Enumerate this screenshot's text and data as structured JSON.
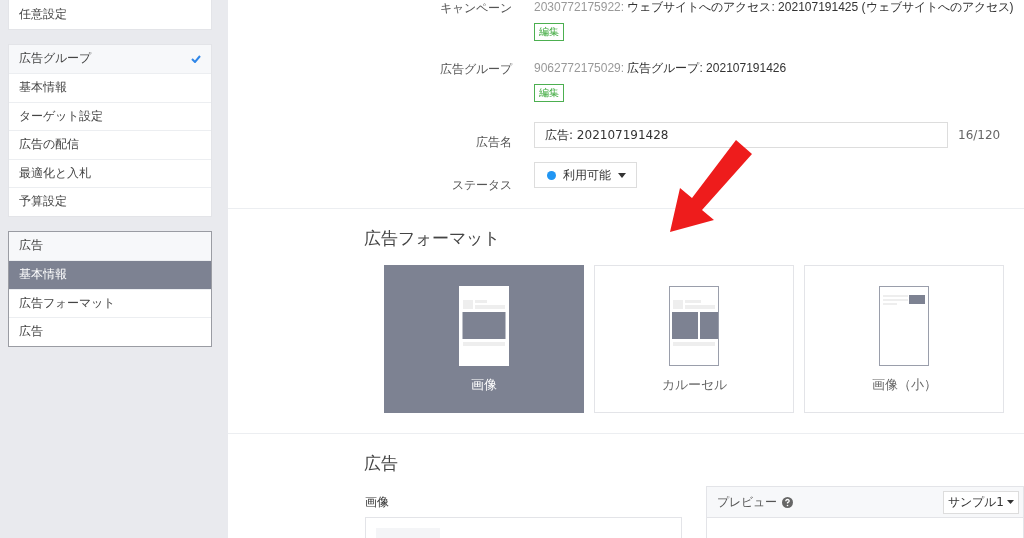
{
  "sidebar": {
    "top_item": "任意設定",
    "groups": [
      {
        "title": "広告グループ",
        "completed": true,
        "items": [
          {
            "label": "基本情報",
            "selected": false
          },
          {
            "label": "ターゲット設定",
            "selected": false
          },
          {
            "label": "広告の配信",
            "selected": false
          },
          {
            "label": "最適化と入札",
            "selected": false
          },
          {
            "label": "予算設定",
            "selected": false
          }
        ]
      },
      {
        "title": "広告",
        "completed": false,
        "items": [
          {
            "label": "基本情報",
            "selected": true
          },
          {
            "label": "広告フォーマット",
            "selected": false
          },
          {
            "label": "広告",
            "selected": false
          }
        ]
      }
    ]
  },
  "form": {
    "campaign": {
      "label": "キャンペーン",
      "id": "2030772175922:",
      "name": "ウェブサイトへのアクセス: 202107191425 (ウェブサイトへのアクセス)",
      "edit": "編集"
    },
    "ad_group": {
      "label": "広告グループ",
      "id": "9062772175029:",
      "name": "広告グループ: 202107191426",
      "edit": "編集"
    },
    "ad_name": {
      "label": "広告名",
      "value": "広告: 202107191428",
      "counter": "16/120"
    },
    "status": {
      "label": "ステータス",
      "value": "利用可能",
      "color": "#2196f3"
    }
  },
  "format": {
    "heading": "広告フォーマット",
    "options": [
      {
        "kind": "image",
        "label": "画像",
        "selected": true
      },
      {
        "kind": "carousel",
        "label": "カルーセル",
        "selected": false
      },
      {
        "kind": "small",
        "label": "画像（小）",
        "selected": false
      }
    ]
  },
  "ad": {
    "heading": "広告",
    "image_label": "画像",
    "preview": {
      "title": "プレビュー",
      "sample": "サンプル1"
    }
  }
}
